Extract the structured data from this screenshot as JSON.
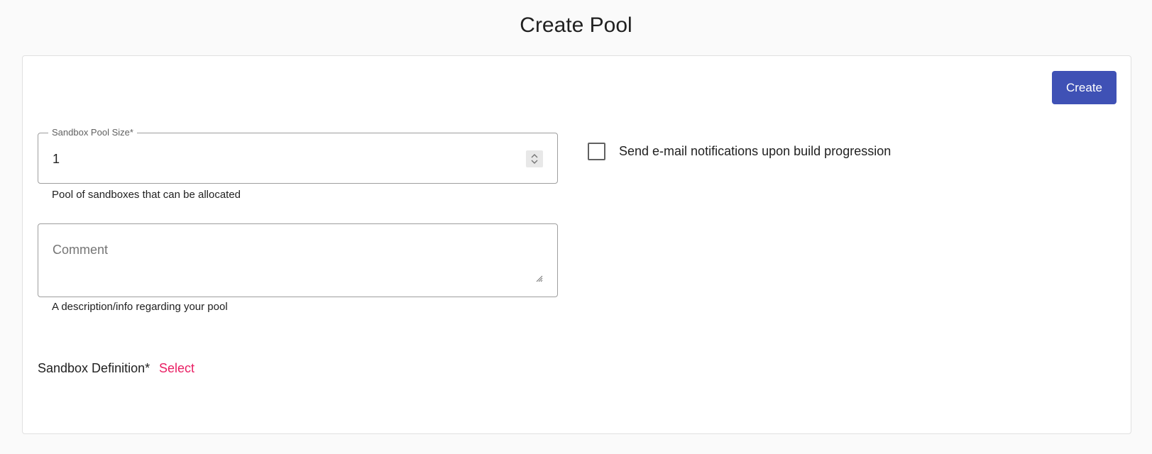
{
  "page": {
    "title": "Create Pool"
  },
  "actions": {
    "create_label": "Create"
  },
  "form": {
    "pool_size": {
      "label": "Sandbox Pool Size*",
      "value": "1",
      "hint": "Pool of sandboxes that can be allocated"
    },
    "comment": {
      "placeholder": "Comment",
      "value": "",
      "hint": "A description/info regarding your pool"
    },
    "email_notifications": {
      "label": "Send e-mail notifications upon build progression",
      "checked": false
    },
    "sandbox_definition": {
      "label": "Sandbox Definition*",
      "select_label": "Select"
    }
  },
  "colors": {
    "primary": "#3f51b5",
    "accent": "#e91e63",
    "background": "#fafafa"
  }
}
